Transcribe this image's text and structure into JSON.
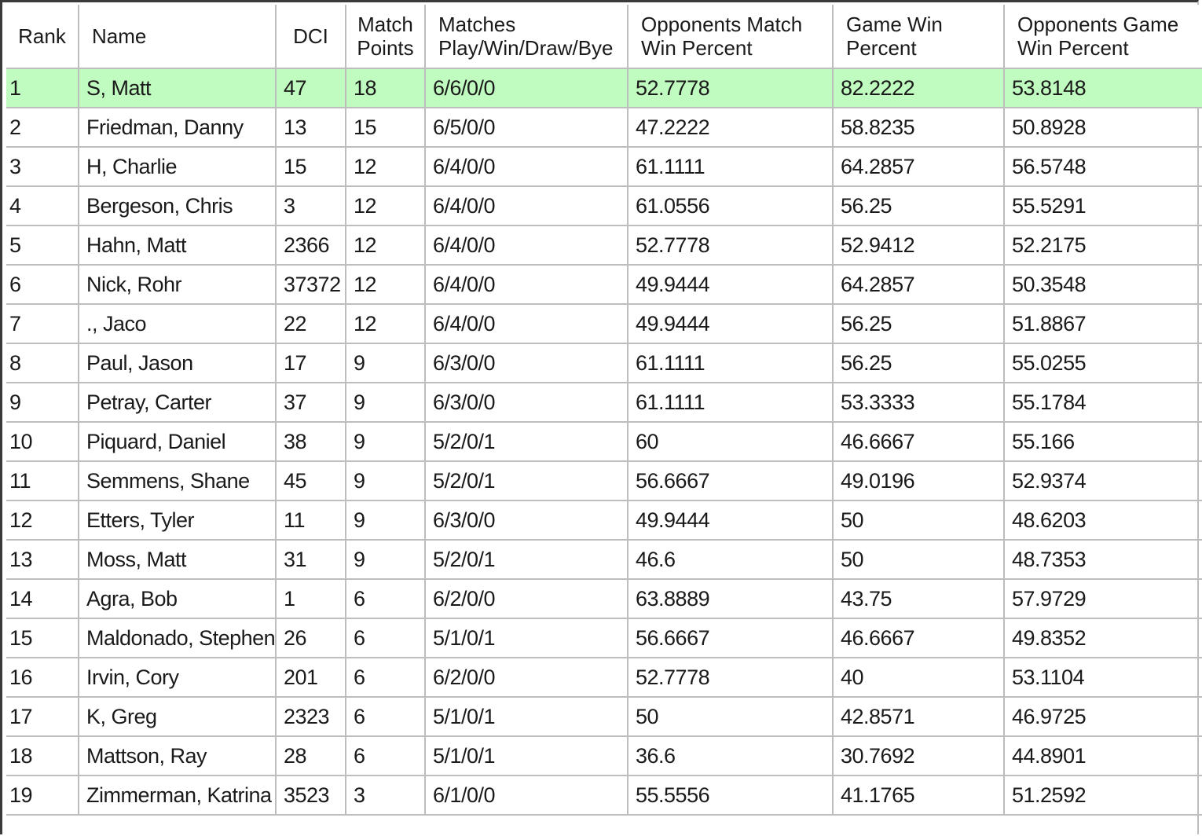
{
  "table": {
    "columns": [
      {
        "key": "rank",
        "lines": [
          "Rank"
        ]
      },
      {
        "key": "name",
        "lines": [
          "Name"
        ]
      },
      {
        "key": "dci",
        "lines": [
          "DCI"
        ]
      },
      {
        "key": "match_points",
        "lines": [
          "Match",
          "Points"
        ]
      },
      {
        "key": "matches",
        "lines": [
          "Matches",
          "Play/Win/Draw/Bye"
        ]
      },
      {
        "key": "omw",
        "lines": [
          "Opponents Match",
          "Win Percent"
        ]
      },
      {
        "key": "gw",
        "lines": [
          "Game Win",
          "Percent"
        ]
      },
      {
        "key": "ogw",
        "lines": [
          "Opponents Game",
          "Win Percent"
        ]
      }
    ],
    "selected_row_index": 0,
    "selected_row_color": "#c0fbbf",
    "rows": [
      [
        "1",
        "S, Matt",
        "47",
        "18",
        "6/6/0/0",
        "52.7778",
        "82.2222",
        "53.8148"
      ],
      [
        "2",
        "Friedman, Danny",
        "13",
        "15",
        "6/5/0/0",
        "47.2222",
        "58.8235",
        "50.8928"
      ],
      [
        "3",
        "H, Charlie",
        "15",
        "12",
        "6/4/0/0",
        "61.1111",
        "64.2857",
        "56.5748"
      ],
      [
        "4",
        "Bergeson, Chris",
        "3",
        "12",
        "6/4/0/0",
        "61.0556",
        "56.25",
        "55.5291"
      ],
      [
        "5",
        "Hahn, Matt",
        "2366",
        "12",
        "6/4/0/0",
        "52.7778",
        "52.9412",
        "52.2175"
      ],
      [
        "6",
        "Nick, Rohr",
        "37372",
        "12",
        "6/4/0/0",
        "49.9444",
        "64.2857",
        "50.3548"
      ],
      [
        "7",
        "., Jaco",
        "22",
        "12",
        "6/4/0/0",
        "49.9444",
        "56.25",
        "51.8867"
      ],
      [
        "8",
        "Paul, Jason",
        "17",
        "9",
        "6/3/0/0",
        "61.1111",
        "56.25",
        "55.0255"
      ],
      [
        "9",
        "Petray, Carter",
        "37",
        "9",
        "6/3/0/0",
        "61.1111",
        "53.3333",
        "55.1784"
      ],
      [
        "10",
        "Piquard, Daniel",
        "38",
        "9",
        "5/2/0/1",
        "60",
        "46.6667",
        "55.166"
      ],
      [
        "11",
        "Semmens, Shane",
        "45",
        "9",
        "5/2/0/1",
        "56.6667",
        "49.0196",
        "52.9374"
      ],
      [
        "12",
        "Etters, Tyler",
        "11",
        "9",
        "6/3/0/0",
        "49.9444",
        "50",
        "48.6203"
      ],
      [
        "13",
        "Moss, Matt",
        "31",
        "9",
        "5/2/0/1",
        "46.6",
        "50",
        "48.7353"
      ],
      [
        "14",
        "Agra, Bob",
        "1",
        "6",
        "6/2/0/0",
        "63.8889",
        "43.75",
        "57.9729"
      ],
      [
        "15",
        "Maldonado, Stephen",
        "26",
        "6",
        "5/1/0/1",
        "56.6667",
        "46.6667",
        "49.8352"
      ],
      [
        "16",
        "Irvin, Cory",
        "201",
        "6",
        "6/2/0/0",
        "52.7778",
        "40",
        "53.1104"
      ],
      [
        "17",
        "K, Greg",
        "2323",
        "6",
        "5/1/0/1",
        "50",
        "42.8571",
        "46.9725"
      ],
      [
        "18",
        "Mattson, Ray",
        "28",
        "6",
        "5/1/0/1",
        "36.6",
        "30.7692",
        "44.8901"
      ],
      [
        "19",
        "Zimmerman, Katrina",
        "3523",
        "3",
        "6/1/0/0",
        "55.5556",
        "41.1765",
        "51.2592"
      ]
    ]
  }
}
